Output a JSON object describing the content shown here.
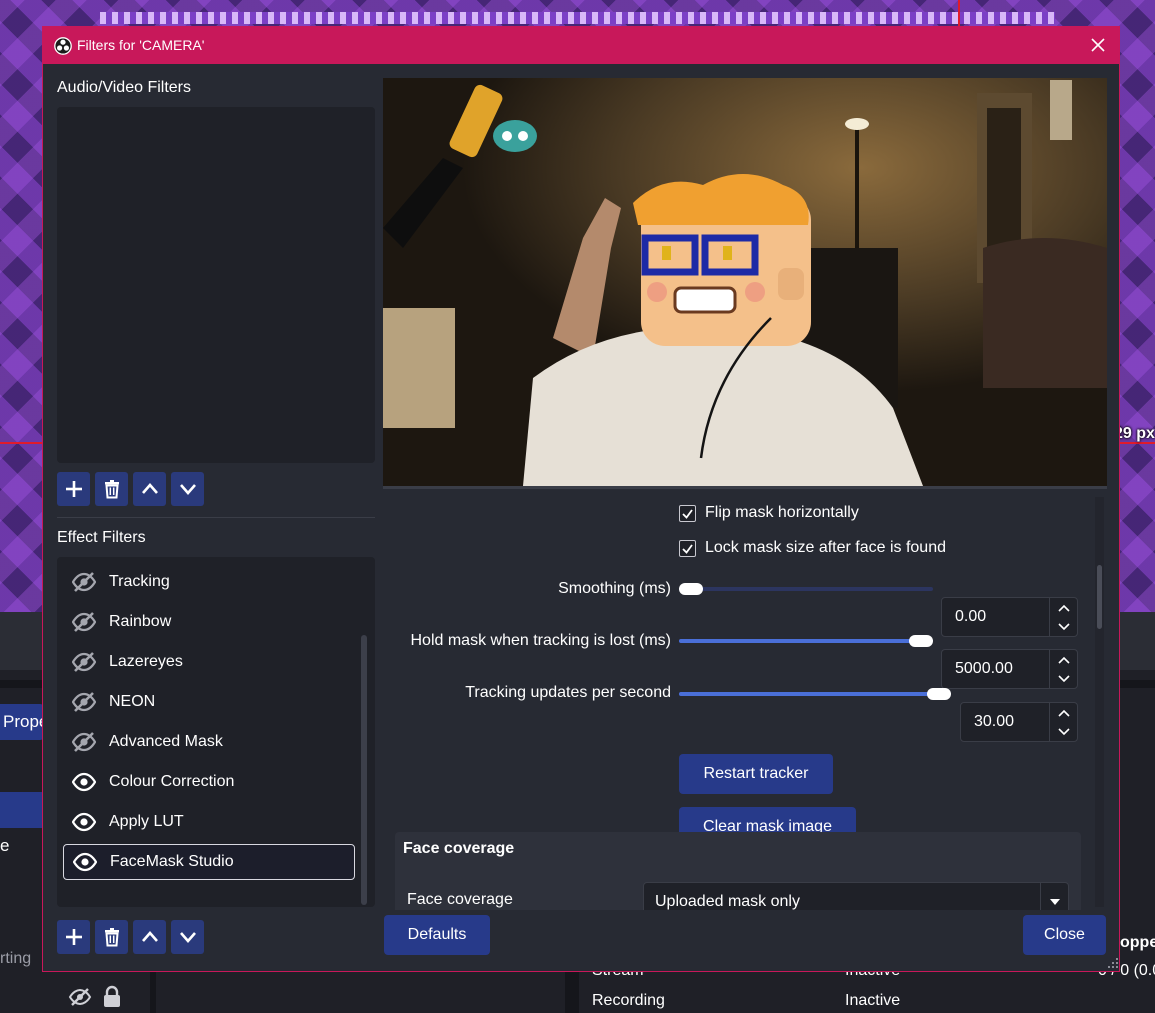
{
  "background": {
    "px_label": "29 px",
    "props_button_label": "Prope",
    "e_label": "e",
    "starting_label": "rting",
    "stats": {
      "stream_label": "Stream",
      "stream_value": "Inactive",
      "recording_label": "Recording",
      "recording_value": "Inactive",
      "dropped_header": "oppe",
      "dropped_value": "0 / 0 (0.0"
    }
  },
  "dialog": {
    "title": "Filters for 'CAMERA'",
    "audio_video_label": "Audio/Video Filters",
    "effect_label": "Effect Filters",
    "effect_filters": [
      {
        "label": "Tracking",
        "visible": false
      },
      {
        "label": "Rainbow",
        "visible": false
      },
      {
        "label": "Lazereyes",
        "visible": false
      },
      {
        "label": "NEON",
        "visible": false
      },
      {
        "label": "Advanced Mask",
        "visible": false
      },
      {
        "label": "Colour Correction",
        "visible": true
      },
      {
        "label": "Apply LUT",
        "visible": true
      },
      {
        "label": "FaceMask Studio",
        "visible": true,
        "selected": true
      }
    ],
    "properties": {
      "flip_mask": {
        "label": "Flip mask horizontally",
        "checked": true
      },
      "lock_mask": {
        "label": "Lock mask size after face is found",
        "checked": true
      },
      "smoothing": {
        "label": "Smoothing (ms)",
        "value": "0.00",
        "fraction": 0.0
      },
      "hold_mask": {
        "label": "Hold mask when tracking is lost (ms)",
        "value": "5000.00",
        "fraction": 1.0
      },
      "tracking_ups": {
        "label": "Tracking updates per second",
        "value": "30.00",
        "fraction": 1.0
      },
      "restart_tracker": "Restart tracker",
      "clear_mask_image": "Clear mask image",
      "face_coverage_group": "Face coverage",
      "face_coverage_label": "Face coverage",
      "face_coverage_value": "Uploaded mask only"
    },
    "defaults_button": "Defaults",
    "close_button": "Close"
  },
  "colors": {
    "accent": "#c8185a",
    "button": "#273a8a",
    "slider_fill": "#4a6fd8",
    "dialog_bg": "#272a33"
  }
}
